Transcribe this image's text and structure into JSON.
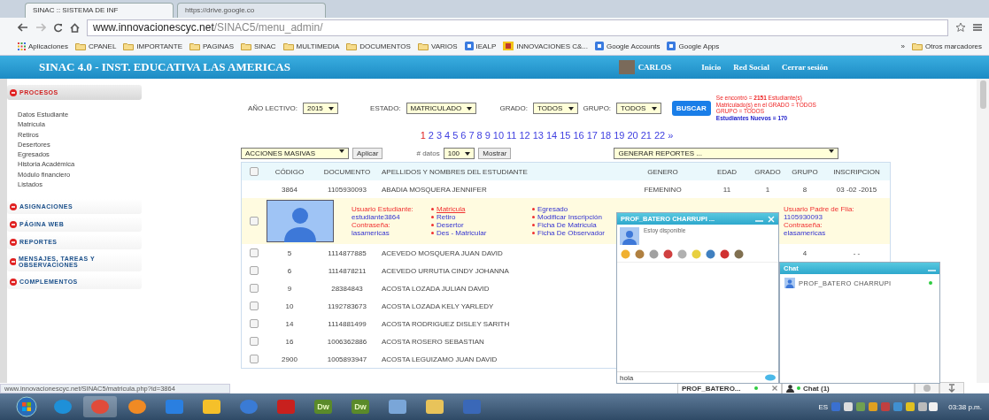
{
  "browser": {
    "tabs": [
      {
        "title": "SINAC :: SISTEMA DE INF",
        "selected": true
      },
      {
        "title": "https://drive.google.co",
        "selected": false
      }
    ],
    "url_host": "www.innovacionescyc.net",
    "url_path": "/SINAC5/menu_admin/",
    "bookmarks": [
      {
        "label": "Aplicaciones",
        "kind": "apps"
      },
      {
        "label": "CPANEL",
        "kind": "folder"
      },
      {
        "label": "IMPORTANTE",
        "kind": "folder"
      },
      {
        "label": "PAGINAS",
        "kind": "folder"
      },
      {
        "label": "SINAC",
        "kind": "folder"
      },
      {
        "label": "MULTIMEDIA",
        "kind": "folder"
      },
      {
        "label": "DOCUMENTOS",
        "kind": "folder"
      },
      {
        "label": "VARIOS",
        "kind": "folder"
      },
      {
        "label": "IEALP",
        "kind": "site"
      },
      {
        "label": "INNOVACIONES C&...",
        "kind": "page"
      },
      {
        "label": "Google Accounts",
        "kind": "site"
      },
      {
        "label": "Google Apps",
        "kind": "site"
      }
    ],
    "more": "»",
    "other_bookmarks": "Otros marcadores"
  },
  "header": {
    "title": "SINAC 4.0 - INST. EDUCATIVA LAS AMERICAS",
    "user": "CARLOS",
    "links": [
      "Inicio",
      "Red Social",
      "Cerrar sesión"
    ]
  },
  "sidebar": {
    "sections": [
      {
        "label": "PROCESOS",
        "expanded": true,
        "children": [
          "Datos Estudiante",
          "Matrícula",
          "Retiros",
          "Desertores",
          "Egresados",
          "Historia Académica",
          "Módulo financiero",
          "Listados"
        ]
      },
      {
        "label": "ASIGNACIONES",
        "expanded": false
      },
      {
        "label": "PÁGINA WEB",
        "expanded": false
      },
      {
        "label": "REPORTES",
        "expanded": false
      },
      {
        "label": "MENSAJES, TAREAS Y OBSERVACIONES",
        "expanded": false
      },
      {
        "label": "COMPLEMENTOS",
        "expanded": false
      }
    ]
  },
  "filters": [
    {
      "label": "AÑO LECTIVO:",
      "value": "2015"
    },
    {
      "label": "ESTADO:",
      "value": "MATRICULADO"
    },
    {
      "label": "GRADO:",
      "value": "TODOS"
    },
    {
      "label": "GRUPO:",
      "value": "TODOS"
    }
  ],
  "search_button": "BUSCAR",
  "results": {
    "found": "Se encontró = **2151** Estudiante(s) Matriculado(s) en el GRADO = TODOS GRUPO = TODOS",
    "new": "Estudiantes Nuevos = 170"
  },
  "pagination": {
    "pages": [
      {
        "label": "1",
        "selected": true
      },
      {
        "label": "2",
        "selected": false
      },
      {
        "label": "3",
        "selected": false
      },
      {
        "label": "4",
        "selected": false
      },
      {
        "label": "5",
        "selected": false
      },
      {
        "label": "6",
        "selected": false
      },
      {
        "label": "7",
        "selected": false
      },
      {
        "label": "8",
        "selected": false
      },
      {
        "label": "9",
        "selected": false
      },
      {
        "label": "10",
        "selected": false
      },
      {
        "label": "11",
        "selected": false
      },
      {
        "label": "12",
        "selected": false
      },
      {
        "label": "13",
        "selected": false
      },
      {
        "label": "14",
        "selected": false
      },
      {
        "label": "15",
        "selected": false
      },
      {
        "label": "16",
        "selected": false
      },
      {
        "label": "17",
        "selected": false
      },
      {
        "label": "18",
        "selected": false
      },
      {
        "label": "19",
        "selected": false
      },
      {
        "label": "20",
        "selected": false
      },
      {
        "label": "21",
        "selected": false
      },
      {
        "label": "22",
        "selected": false
      }
    ],
    "next": "»"
  },
  "actions": {
    "bulk": "ACCIONES MASIVAS",
    "apply": "Aplicar",
    "per_page_label": "# datos",
    "per_page": "100",
    "show": "Mostrar",
    "reports": "GENERAR REPORTES ..."
  },
  "table": {
    "columns": [
      "CÓDIGO",
      "DOCUMENTO",
      "APELLIDOS Y NOMBRES DEL ESTUDIANTE",
      "GENERO",
      "EDAD",
      "GRADO",
      "GRUPO",
      "INSCRIPCION"
    ],
    "header_checked": false,
    "rows": [
      {
        "cells": [
          "3864",
          "1105930093",
          "ABADIA MOSQUERA JENNIFER",
          "FEMENINO",
          "11",
          "1",
          "8",
          "03 -02 -2015"
        ],
        "kind": "plain"
      },
      {
        "kind": "detail",
        "checked": false,
        "student_user_label": "Usuario Estudiante:",
        "student_user": "estudiante3864",
        "password_label": "Contraseña:",
        "student_password": "lasamericas",
        "actions": [
          {
            "label": "Matricula",
            "selected": true
          },
          {
            "label": "Retiro",
            "selected": false
          },
          {
            "label": "Desertor",
            "selected": false
          },
          {
            "label": "Des - Matricular",
            "selected": false
          }
        ],
        "actions_2": [
          {
            "label": "Egresado",
            "selected": false
          },
          {
            "label": "Modificar Inscripción",
            "selected": false
          },
          {
            "label": "Ficha De Matricula",
            "selected": false
          },
          {
            "label": "Ficha De Observador",
            "selected": false
          }
        ],
        "parent_user_label": "Usuario Padre de Flia:",
        "parent_user": "1105930093",
        "parent_password_label": "Contraseña:",
        "parent_password": "elasamericas"
      },
      {
        "kind": "check",
        "checked": false,
        "cells": [
          "5",
          "1114877885",
          "ACEVEDO MOSQUERA JUAN DAVID",
          "",
          "",
          "",
          "4",
          "- -"
        ]
      },
      {
        "kind": "check",
        "checked": false,
        "cells": [
          "6",
          "1114878211",
          "ACEVEDO URRUTIA CINDY JOHANNA",
          "",
          "",
          "",
          "",
          ""
        ]
      },
      {
        "kind": "check",
        "checked": false,
        "cells": [
          "9",
          "28384843",
          "ACOSTA LOZADA JULIAN DAVID",
          "",
          "",
          "",
          "",
          ""
        ]
      },
      {
        "kind": "check",
        "checked": false,
        "cells": [
          "10",
          "1192783673",
          "ACOSTA LOZADA KELY YARLEDY",
          "",
          "",
          "",
          "",
          ""
        ]
      },
      {
        "kind": "check",
        "checked": false,
        "cells": [
          "14",
          "1114881499",
          "ACOSTA RODRIGUEZ DISLEY SARITH",
          "",
          "",
          "",
          "",
          ""
        ]
      },
      {
        "kind": "check",
        "checked": false,
        "cells": [
          "16",
          "1006362886",
          "ACOSTA ROSERO SEBASTIAN",
          "",
          "",
          "",
          "",
          ""
        ]
      },
      {
        "kind": "check",
        "checked": false,
        "cells": [
          "2900",
          "1005893947",
          "ACOSTA LEGUIZAMO JUAN DAVID",
          "",
          "",
          "",
          "",
          ""
        ]
      }
    ]
  },
  "chat_window": {
    "title": "PROF_BATERO CHARRUPI ...",
    "status": "Estoy disponible",
    "message": "hola"
  },
  "chat_list": {
    "title": "Chat",
    "contacts": [
      {
        "name": "PROF_BATERO CHARRUPI",
        "online": true
      }
    ]
  },
  "chat_bar": {
    "tabs": [
      {
        "label": "PROF_BATERO...",
        "online": true,
        "kind": "conversation"
      },
      {
        "label": "Chat (1)",
        "online": true,
        "kind": "list"
      }
    ]
  },
  "status_url": "www.innovacionescyc.net/SINAC5/matricula.php?id=3864",
  "taskbar": {
    "apps": [
      {
        "kind": "ie"
      },
      {
        "kind": "chrome",
        "selected": true
      },
      {
        "kind": "firefox"
      },
      {
        "kind": "dropbox"
      },
      {
        "kind": "drive"
      },
      {
        "kind": "globe"
      },
      {
        "kind": "filezilla"
      },
      {
        "kind": "dw",
        "label": "Dw"
      },
      {
        "kind": "dw",
        "label": "Dw"
      },
      {
        "kind": "window"
      },
      {
        "kind": "folder"
      },
      {
        "kind": "chart"
      }
    ],
    "language": "ES",
    "clock": "03:38 p.m."
  }
}
